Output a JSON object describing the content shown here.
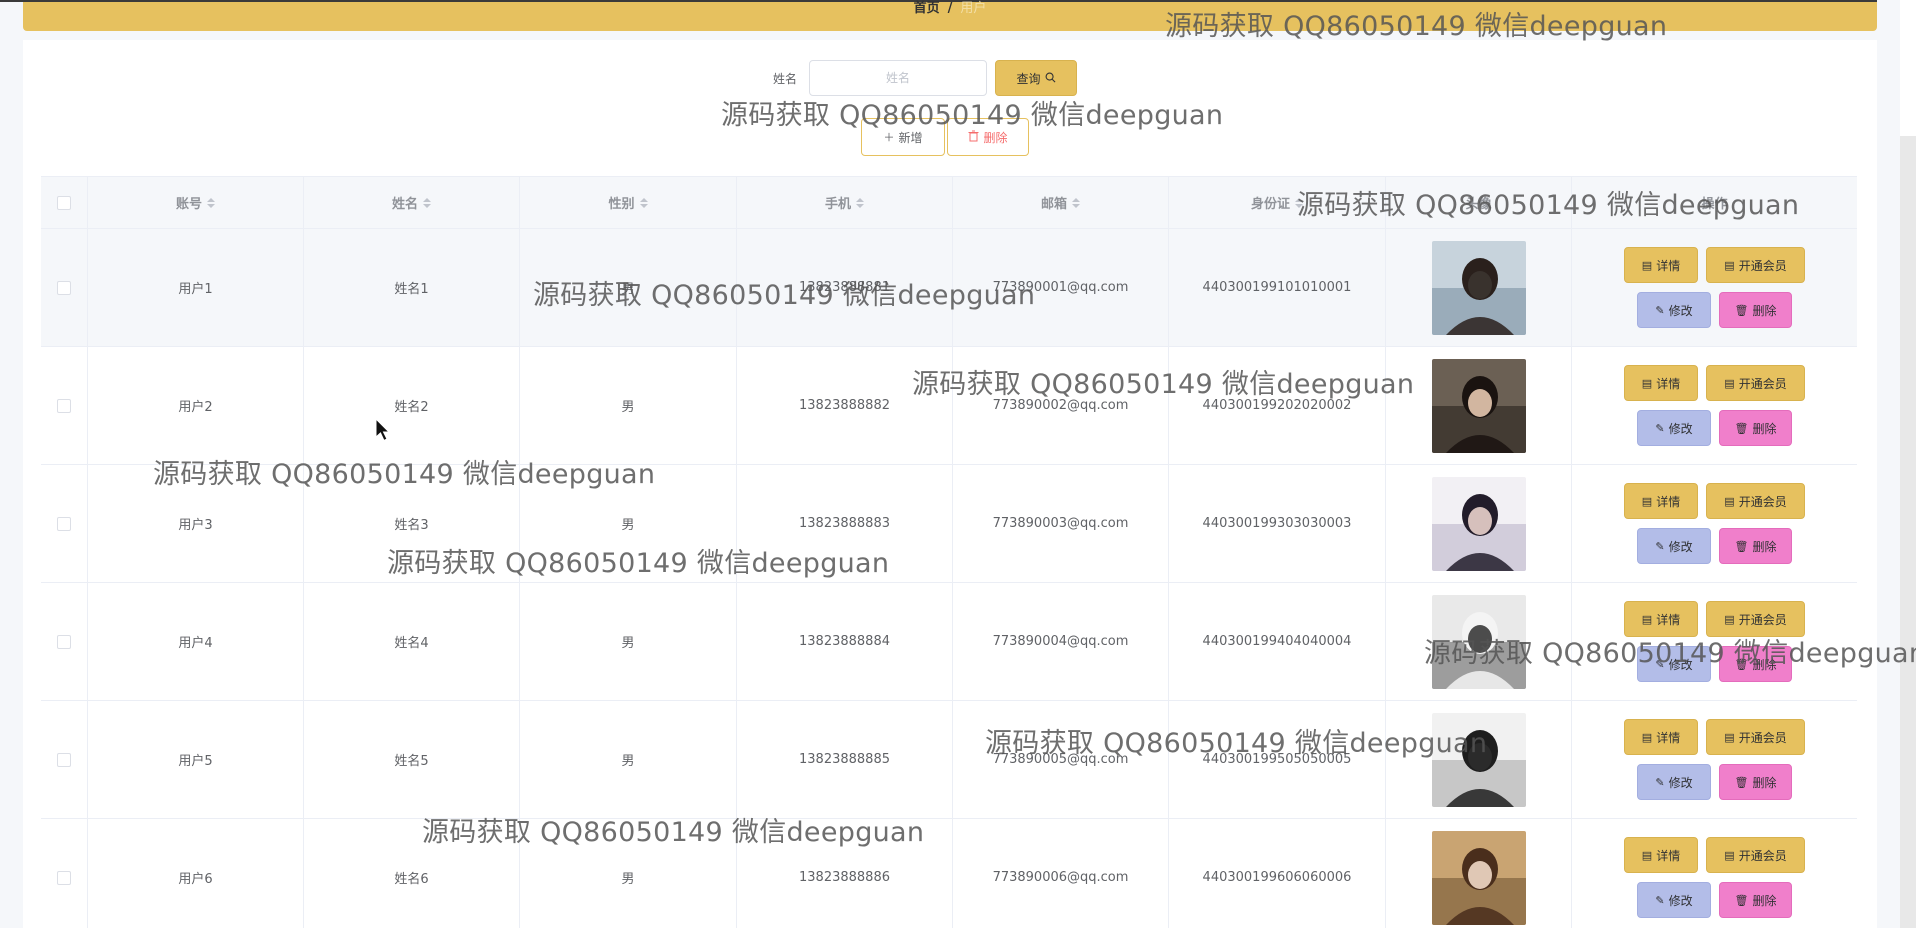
{
  "breadcrumb": {
    "home": "首页",
    "separator": "/",
    "current": "用户"
  },
  "search": {
    "label": "姓名",
    "placeholder": "姓名",
    "value": "",
    "button_label": "查询",
    "button_icon": "search-icon"
  },
  "actions": {
    "add_label": "新增",
    "add_icon": "plus-icon",
    "delete_label": "删除",
    "delete_icon": "trash-icon"
  },
  "table": {
    "columns": [
      "账号",
      "姓名",
      "性别",
      "手机",
      "邮箱",
      "身份证",
      "头像",
      "操作"
    ],
    "rows": [
      {
        "account": "用户1",
        "name": "姓名1",
        "gender": "男",
        "phone": "13823888881",
        "email": "773890001@qq.com",
        "id_card": "440300199101010001"
      },
      {
        "account": "用户2",
        "name": "姓名2",
        "gender": "男",
        "phone": "13823888882",
        "email": "773890002@qq.com",
        "id_card": "440300199202020002"
      },
      {
        "account": "用户3",
        "name": "姓名3",
        "gender": "男",
        "phone": "13823888883",
        "email": "773890003@qq.com",
        "id_card": "440300199303030003"
      },
      {
        "account": "用户4",
        "name": "姓名4",
        "gender": "男",
        "phone": "13823888884",
        "email": "773890004@qq.com",
        "id_card": "440300199404040004"
      },
      {
        "account": "用户5",
        "name": "姓名5",
        "gender": "男",
        "phone": "13823888885",
        "email": "773890005@qq.com",
        "id_card": "440300199505050005"
      },
      {
        "account": "用户6",
        "name": "姓名6",
        "gender": "男",
        "phone": "13823888886",
        "email": "773890006@qq.com",
        "id_card": "440300199606060006"
      }
    ],
    "row_actions": {
      "detail": "详情",
      "vip": "开通会员",
      "edit": "修改",
      "remove": "删除"
    }
  },
  "watermark": {
    "text": "源码获取 QQ86050149 微信deepguan"
  },
  "colors": {
    "accent": "#e6c15f",
    "edit": "#b3bde8",
    "remove": "#f07fcb",
    "danger": "#f56c6c"
  }
}
